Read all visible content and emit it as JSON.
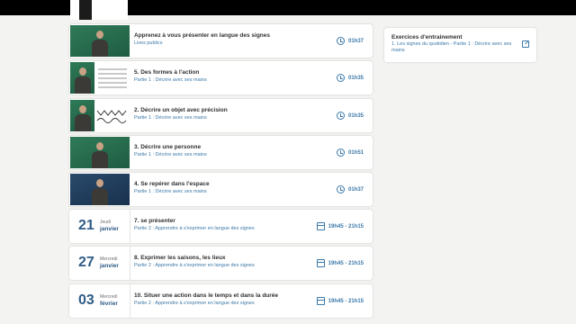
{
  "sessions": [
    {
      "kind": "video",
      "thumb": "green-signer",
      "title": "Apprenez à vous présenter en langue des signes",
      "subtitle": "Lives publics",
      "duration": "01h37",
      "meta_icon": "clock-icon"
    },
    {
      "kind": "video",
      "thumb": "split-signer-document",
      "title": "5. Des formes à l'action",
      "subtitle": "Partie 1 : Décrire avec ses mains",
      "duration": "01h35",
      "meta_icon": "clock-icon"
    },
    {
      "kind": "video",
      "thumb": "split-signer-waves",
      "title": "2. Décrire un objet avec précision",
      "subtitle": "Partie 1 : Décrire avec ses mains",
      "duration": "01h35",
      "meta_icon": "clock-icon"
    },
    {
      "kind": "video",
      "thumb": "green-signer",
      "title": "3. Décrire une personne",
      "subtitle": "Partie 1 : Décrire avec ses mains",
      "duration": "01h51",
      "meta_icon": "clock-icon"
    },
    {
      "kind": "video",
      "thumb": "navy-signer",
      "title": "4. Se repérer dans l'espace",
      "subtitle": "Partie 1 : Décrire avec ses mains",
      "duration": "01h37",
      "meta_icon": "clock-icon"
    },
    {
      "kind": "date",
      "day": "21",
      "weekday": "Jeudi",
      "month": "janvier",
      "title": "7. se présenter",
      "subtitle": "Partie 2 : Apprendre à s'exprimer en langue des signes",
      "time": "19h45 - 21h15",
      "meta_icon": "calendar-icon"
    },
    {
      "kind": "date",
      "day": "27",
      "weekday": "Mercredi",
      "month": "janvier",
      "title": "8. Exprimer les saisons, les lieux",
      "subtitle": "Partie 2 : Apprendre à s'exprimer en langue des signes",
      "time": "19h45 - 21h15",
      "meta_icon": "calendar-icon"
    },
    {
      "kind": "date",
      "day": "03",
      "weekday": "Mercredi",
      "month": "février",
      "title": "10. Situer une action dans le temps et dans la durée",
      "subtitle": "Partie 2 : Apprendre à s'exprimer en langue des signes",
      "time": "19h45 - 21h15",
      "meta_icon": "calendar-icon"
    }
  ],
  "exercises": {
    "title": "Exercices d'entrainement",
    "link": "1. Les signes du quotidien - Partie 1 : Décrire avec ses mains",
    "link_icon": "external-link-icon"
  },
  "colors": {
    "accent": "#3b78a8",
    "date_blue": "#2f5b86",
    "page_bg": "#f3f3f1",
    "thumb_green": "#2f7a58",
    "thumb_navy": "#2a4a6b"
  }
}
